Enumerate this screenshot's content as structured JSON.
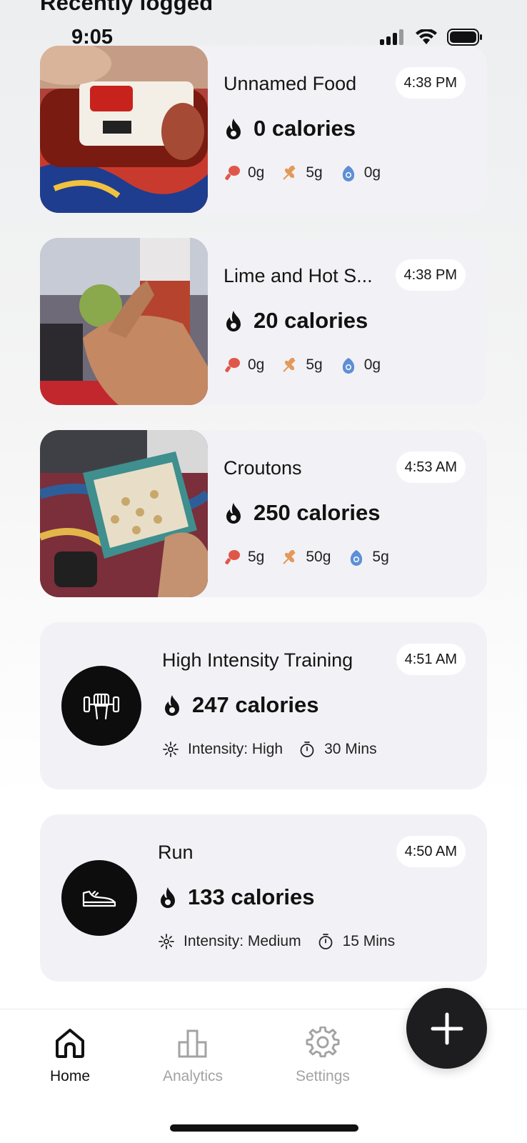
{
  "header": {
    "section_title": "Recently logged"
  },
  "status_bar": {
    "time": "9:05",
    "icons": [
      "signal-icon",
      "wifi-icon",
      "battery-icon"
    ]
  },
  "entries": [
    {
      "kind": "food",
      "title": "Unnamed Food",
      "time": "4:38 PM",
      "calories": "0 calories",
      "protein": "0g",
      "carbs": "5g",
      "fat": "0g"
    },
    {
      "kind": "food",
      "title": "Lime and Hot S...",
      "time": "4:38 PM",
      "calories": "20 calories",
      "protein": "0g",
      "carbs": "5g",
      "fat": "0g"
    },
    {
      "kind": "food",
      "title": "Croutons",
      "time": "4:53 AM",
      "calories": "250 calories",
      "protein": "5g",
      "carbs": "50g",
      "fat": "5g"
    },
    {
      "kind": "exercise",
      "icon": "dumbbell-icon",
      "title": "High Intensity Training",
      "time": "4:51 AM",
      "calories": "247 calories",
      "intensity": "Intensity: High",
      "duration": "30 Mins"
    },
    {
      "kind": "exercise",
      "icon": "shoe-icon",
      "title": "Run",
      "time": "4:50 AM",
      "calories": "133 calories",
      "intensity": "Intensity: Medium",
      "duration": "15 Mins"
    }
  ],
  "tabbar": {
    "home": "Home",
    "analytics": "Analytics",
    "settings": "Settings",
    "active": "Home"
  },
  "fab": {
    "icon": "plus-icon"
  },
  "colors": {
    "protein": "#e0574a",
    "carbs": "#e3995a",
    "fat": "#5e8fd6",
    "card_bg": "#f2f2f6",
    "active_tab": "#111111",
    "inactive_tab": "#a3a3a3"
  }
}
